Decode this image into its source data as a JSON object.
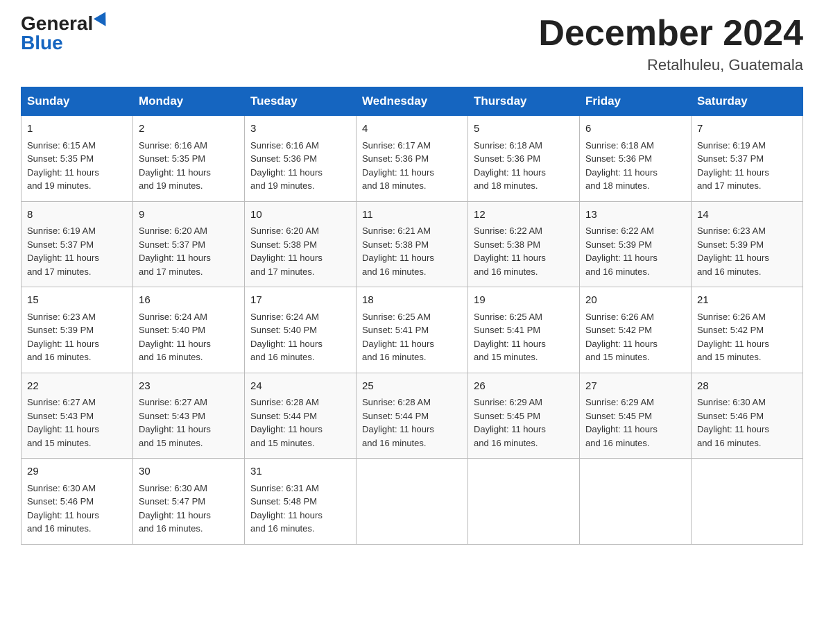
{
  "header": {
    "logo": {
      "general": "General",
      "blue": "Blue"
    },
    "title": "December 2024",
    "subtitle": "Retalhuleu, Guatemala"
  },
  "weekdays": [
    "Sunday",
    "Monday",
    "Tuesday",
    "Wednesday",
    "Thursday",
    "Friday",
    "Saturday"
  ],
  "weeks": [
    [
      {
        "day": "1",
        "sunrise": "6:15 AM",
        "sunset": "5:35 PM",
        "daylight": "11 hours and 19 minutes."
      },
      {
        "day": "2",
        "sunrise": "6:16 AM",
        "sunset": "5:35 PM",
        "daylight": "11 hours and 19 minutes."
      },
      {
        "day": "3",
        "sunrise": "6:16 AM",
        "sunset": "5:36 PM",
        "daylight": "11 hours and 19 minutes."
      },
      {
        "day": "4",
        "sunrise": "6:17 AM",
        "sunset": "5:36 PM",
        "daylight": "11 hours and 18 minutes."
      },
      {
        "day": "5",
        "sunrise": "6:18 AM",
        "sunset": "5:36 PM",
        "daylight": "11 hours and 18 minutes."
      },
      {
        "day": "6",
        "sunrise": "6:18 AM",
        "sunset": "5:36 PM",
        "daylight": "11 hours and 18 minutes."
      },
      {
        "day": "7",
        "sunrise": "6:19 AM",
        "sunset": "5:37 PM",
        "daylight": "11 hours and 17 minutes."
      }
    ],
    [
      {
        "day": "8",
        "sunrise": "6:19 AM",
        "sunset": "5:37 PM",
        "daylight": "11 hours and 17 minutes."
      },
      {
        "day": "9",
        "sunrise": "6:20 AM",
        "sunset": "5:37 PM",
        "daylight": "11 hours and 17 minutes."
      },
      {
        "day": "10",
        "sunrise": "6:20 AM",
        "sunset": "5:38 PM",
        "daylight": "11 hours and 17 minutes."
      },
      {
        "day": "11",
        "sunrise": "6:21 AM",
        "sunset": "5:38 PM",
        "daylight": "11 hours and 16 minutes."
      },
      {
        "day": "12",
        "sunrise": "6:22 AM",
        "sunset": "5:38 PM",
        "daylight": "11 hours and 16 minutes."
      },
      {
        "day": "13",
        "sunrise": "6:22 AM",
        "sunset": "5:39 PM",
        "daylight": "11 hours and 16 minutes."
      },
      {
        "day": "14",
        "sunrise": "6:23 AM",
        "sunset": "5:39 PM",
        "daylight": "11 hours and 16 minutes."
      }
    ],
    [
      {
        "day": "15",
        "sunrise": "6:23 AM",
        "sunset": "5:39 PM",
        "daylight": "11 hours and 16 minutes."
      },
      {
        "day": "16",
        "sunrise": "6:24 AM",
        "sunset": "5:40 PM",
        "daylight": "11 hours and 16 minutes."
      },
      {
        "day": "17",
        "sunrise": "6:24 AM",
        "sunset": "5:40 PM",
        "daylight": "11 hours and 16 minutes."
      },
      {
        "day": "18",
        "sunrise": "6:25 AM",
        "sunset": "5:41 PM",
        "daylight": "11 hours and 16 minutes."
      },
      {
        "day": "19",
        "sunrise": "6:25 AM",
        "sunset": "5:41 PM",
        "daylight": "11 hours and 15 minutes."
      },
      {
        "day": "20",
        "sunrise": "6:26 AM",
        "sunset": "5:42 PM",
        "daylight": "11 hours and 15 minutes."
      },
      {
        "day": "21",
        "sunrise": "6:26 AM",
        "sunset": "5:42 PM",
        "daylight": "11 hours and 15 minutes."
      }
    ],
    [
      {
        "day": "22",
        "sunrise": "6:27 AM",
        "sunset": "5:43 PM",
        "daylight": "11 hours and 15 minutes."
      },
      {
        "day": "23",
        "sunrise": "6:27 AM",
        "sunset": "5:43 PM",
        "daylight": "11 hours and 15 minutes."
      },
      {
        "day": "24",
        "sunrise": "6:28 AM",
        "sunset": "5:44 PM",
        "daylight": "11 hours and 15 minutes."
      },
      {
        "day": "25",
        "sunrise": "6:28 AM",
        "sunset": "5:44 PM",
        "daylight": "11 hours and 16 minutes."
      },
      {
        "day": "26",
        "sunrise": "6:29 AM",
        "sunset": "5:45 PM",
        "daylight": "11 hours and 16 minutes."
      },
      {
        "day": "27",
        "sunrise": "6:29 AM",
        "sunset": "5:45 PM",
        "daylight": "11 hours and 16 minutes."
      },
      {
        "day": "28",
        "sunrise": "6:30 AM",
        "sunset": "5:46 PM",
        "daylight": "11 hours and 16 minutes."
      }
    ],
    [
      {
        "day": "29",
        "sunrise": "6:30 AM",
        "sunset": "5:46 PM",
        "daylight": "11 hours and 16 minutes."
      },
      {
        "day": "30",
        "sunrise": "6:30 AM",
        "sunset": "5:47 PM",
        "daylight": "11 hours and 16 minutes."
      },
      {
        "day": "31",
        "sunrise": "6:31 AM",
        "sunset": "5:48 PM",
        "daylight": "11 hours and 16 minutes."
      },
      null,
      null,
      null,
      null
    ]
  ],
  "labels": {
    "sunrise": "Sunrise:",
    "sunset": "Sunset:",
    "daylight": "Daylight:"
  }
}
